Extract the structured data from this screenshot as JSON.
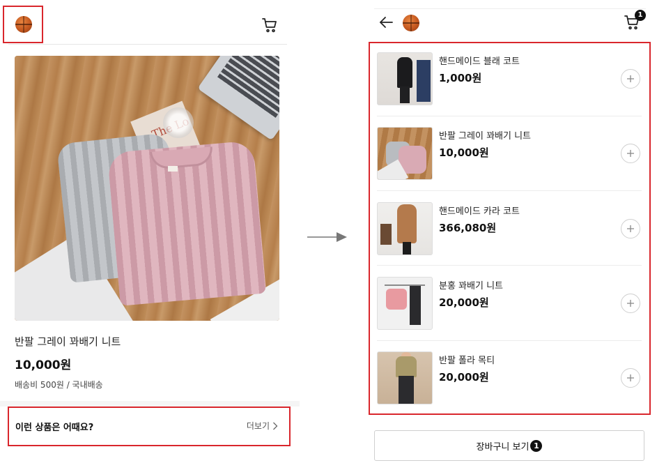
{
  "left_screen": {
    "product": {
      "name": "반팔 그레이 꽈배기 니트",
      "price": "10,000원",
      "shipping": "배송비 500원 / 국내배송",
      "image_book_text": "The Lo"
    },
    "recommend": {
      "title": "이런 상품은 어때요?",
      "more_label": "더보기"
    }
  },
  "right_screen": {
    "cart_badge": "1",
    "items": [
      {
        "name": "핸드메이드 블래 코트",
        "price": "1,000원"
      },
      {
        "name": "반팔 그레이 꽈배기 니트",
        "price": "10,000원"
      },
      {
        "name": "핸드메이드 카라 코트",
        "price": "366,080원"
      },
      {
        "name": "분홍 꽈배기 니트",
        "price": "20,000원"
      },
      {
        "name": "반팔 폴라 목티",
        "price": "20,000원"
      }
    ],
    "cart_button": {
      "label": "장바구니 보기",
      "count": "1"
    }
  },
  "icons": {
    "logo": "basketball-logo-icon",
    "cart": "cart-icon",
    "back": "arrow-left-icon",
    "add": "plus-icon",
    "more": "chevron-right-icon",
    "flow": "arrow-right-icon"
  },
  "colors": {
    "highlight": "#d9262c",
    "text": "#111111",
    "divider": "#e6e6e6"
  }
}
